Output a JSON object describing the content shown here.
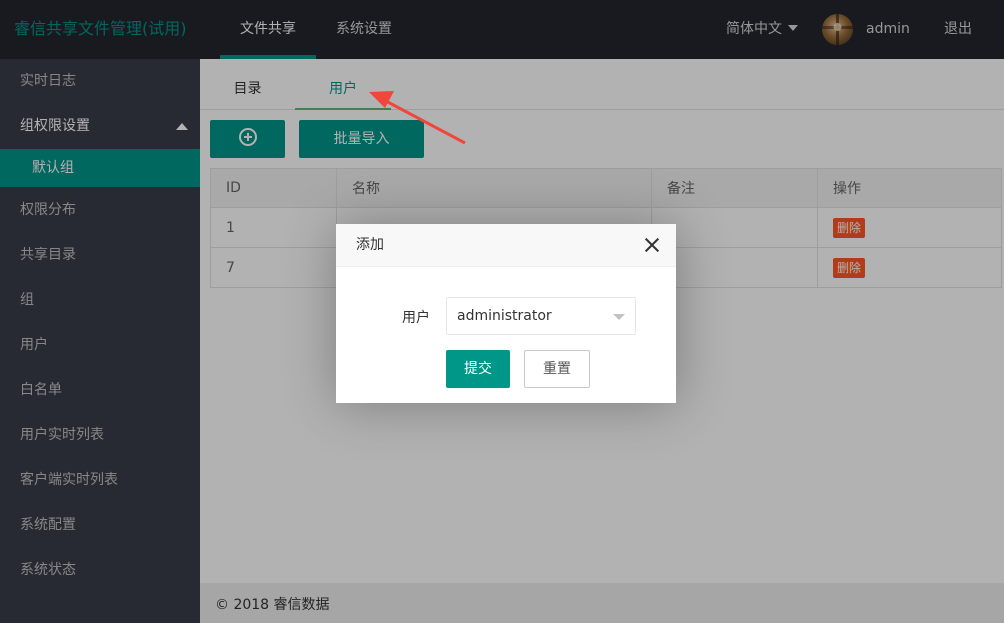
{
  "header": {
    "app_title": "睿信共享文件管理(试用)",
    "nav": [
      {
        "label": "文件共享",
        "active": true
      },
      {
        "label": "系统设置",
        "active": false
      }
    ],
    "language": "简体中文",
    "username": "admin",
    "logout": "退出"
  },
  "sidebar": {
    "items": [
      {
        "label": "实时日志"
      },
      {
        "label": "组权限设置",
        "expanded": true
      },
      {
        "label": "默认组",
        "active": true
      },
      {
        "label": "权限分布"
      },
      {
        "label": "共享目录"
      },
      {
        "label": "组"
      },
      {
        "label": "用户"
      },
      {
        "label": "白名单"
      },
      {
        "label": "用户实时列表"
      },
      {
        "label": "客户端实时列表"
      },
      {
        "label": "系统配置"
      },
      {
        "label": "系统状态"
      }
    ]
  },
  "main": {
    "tabs": [
      {
        "label": "目录",
        "active": false
      },
      {
        "label": "用户",
        "active": true
      }
    ],
    "buttons": {
      "add_icon": "plus-circle-icon",
      "batch_import": "批量导入"
    },
    "table": {
      "columns": [
        "ID",
        "名称",
        "备注",
        "操作"
      ],
      "rows": [
        {
          "id": "1",
          "name": "",
          "note": "",
          "action": "删除"
        },
        {
          "id": "7",
          "name": "",
          "note": "",
          "action": "删除"
        }
      ]
    }
  },
  "footer": {
    "text": "© 2018 睿信数据"
  },
  "dialog": {
    "title": "添加",
    "field_label": "用户",
    "select_value": "administrator",
    "submit": "提交",
    "reset": "重置"
  },
  "colors": {
    "accent": "#009688",
    "header_bg": "#23262e",
    "sidebar_bg": "#393d49",
    "danger": "#ff5722",
    "annotation_arrow": "#f0463c"
  }
}
